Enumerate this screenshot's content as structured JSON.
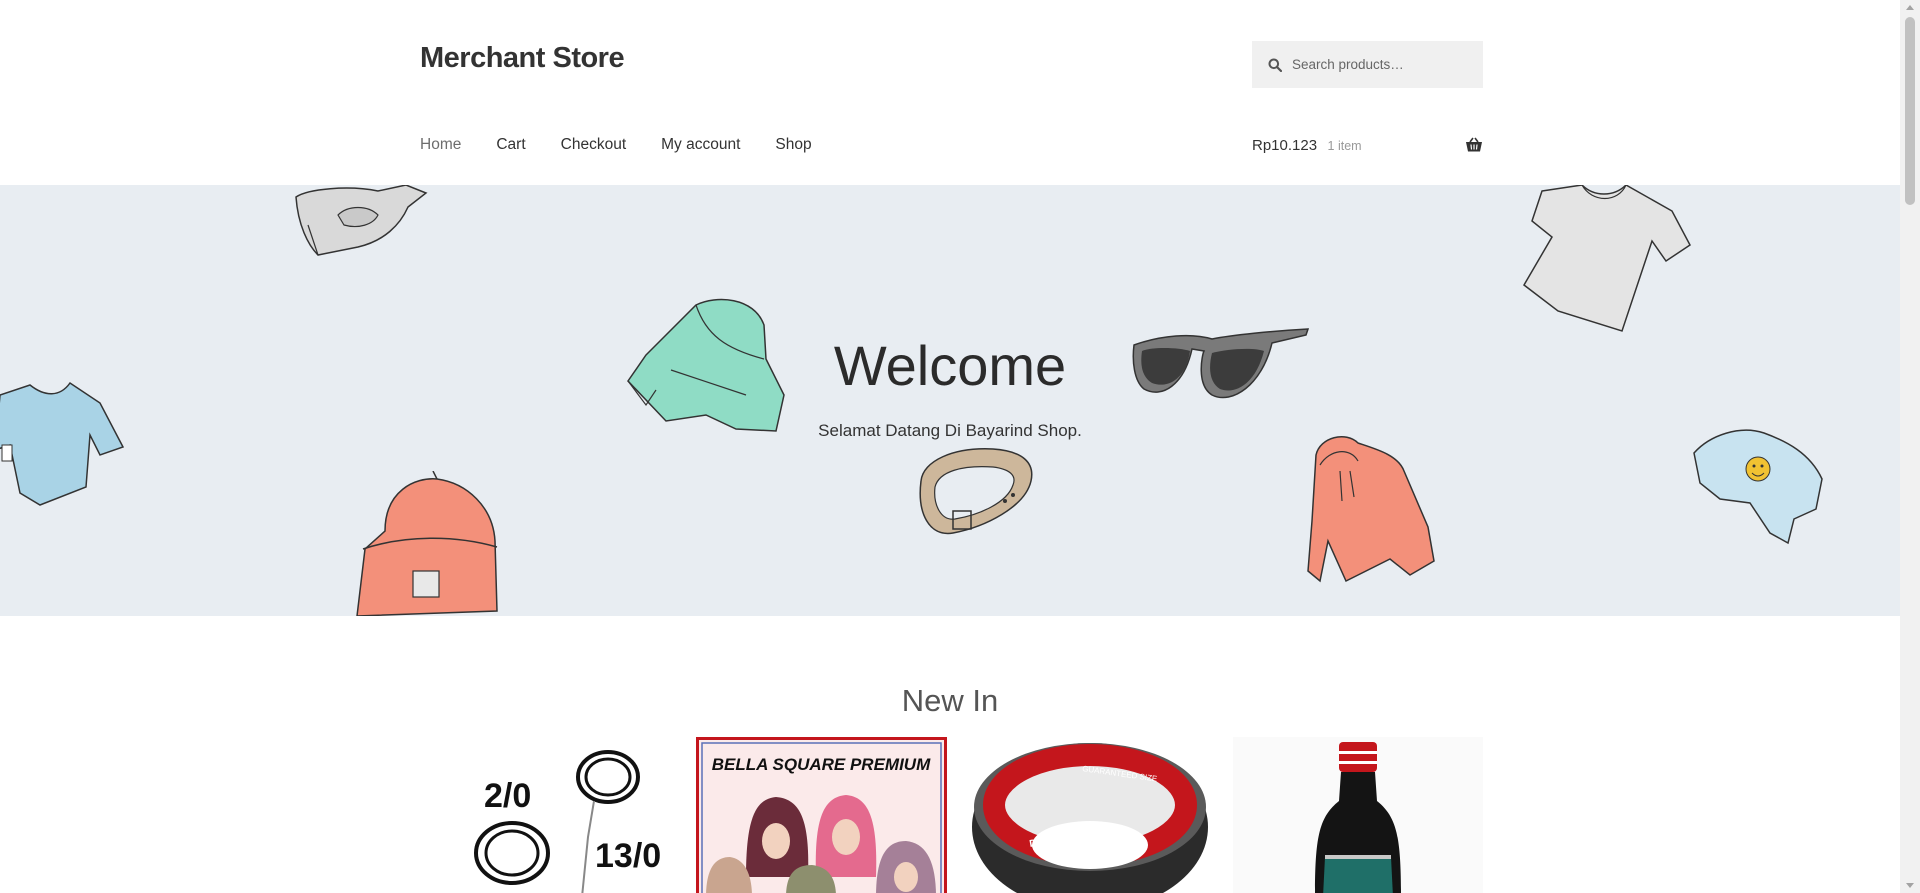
{
  "site": {
    "title": "Merchant Store"
  },
  "search": {
    "placeholder": "Search products…"
  },
  "nav": {
    "items": [
      {
        "label": "Home"
      },
      {
        "label": "Cart"
      },
      {
        "label": "Checkout"
      },
      {
        "label": "My account"
      },
      {
        "label": "Shop"
      }
    ]
  },
  "cart": {
    "amount": "Rp10.123",
    "count": "1 item"
  },
  "hero": {
    "title": "Welcome",
    "subtitle": "Selamat Datang Di Bayarind Shop.",
    "background": "#e8edf2",
    "illustrations": [
      "hoodie-gray",
      "tshirt-blue",
      "beanie-orange",
      "hoodie-mint",
      "belt",
      "sunglasses",
      "hoodie-coral",
      "tshirt-gray",
      "sweatshirt-lightblue"
    ]
  },
  "new_in": {
    "title": "New In",
    "products": [
      {
        "image": "wire-product",
        "labels": [
          "2/0",
          "13/0"
        ]
      },
      {
        "image": "hijab-product",
        "labels": [
          "BELLA SQUARE PREMIUM"
        ]
      },
      {
        "image": "tape-product",
        "labels": [
          "DAIMARU TAPE",
          "GUARANTEED SIZE"
        ]
      },
      {
        "image": "sauce-bottle-product",
        "labels": []
      }
    ]
  },
  "colors": {
    "accent_red": "#c4161c",
    "hero_bg": "#e8edf2"
  }
}
